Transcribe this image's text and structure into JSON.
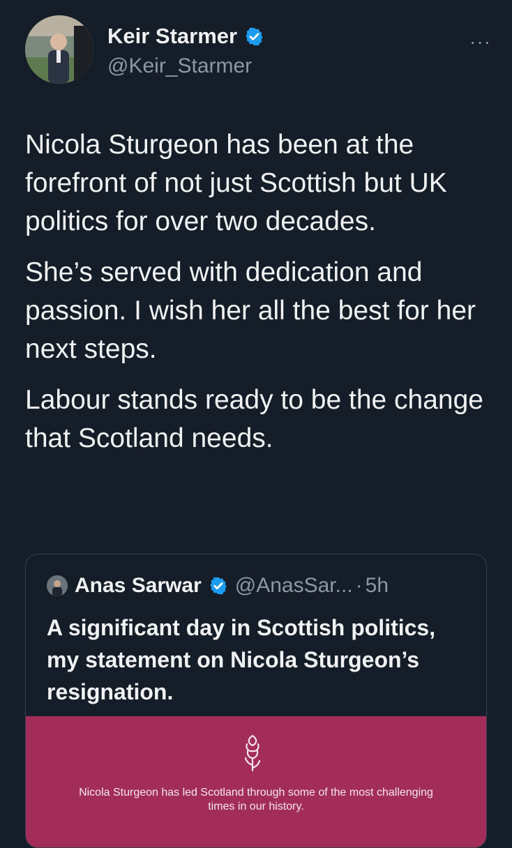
{
  "author": {
    "display_name": "Keir Starmer",
    "handle": "@Keir_Starmer",
    "verified_icon": "verified-badge-icon",
    "more_label": "···"
  },
  "tweet": {
    "paragraphs": [
      "Nicola Sturgeon has been at the forefront of not just Scottish but UK politics for over two decades.",
      "She’s served with dedication and passion. I wish her all the best for her next steps.",
      "Labour stands ready to be the change that Scotland needs."
    ]
  },
  "quoted_tweet": {
    "display_name": "Anas Sarwar",
    "handle": "@AnasSar...",
    "separator": "·",
    "time": "5h",
    "text": "A significant day in Scottish politics, my statement on Nicola Sturgeon’s resignation.",
    "media_text": "Nicola Sturgeon has led Scotland through some of the most challenging times in our history.",
    "media_color": "#a32d59"
  },
  "colors": {
    "background": "#151d28",
    "verified": "#1d9bf0",
    "secondary_text": "#8b98a5"
  }
}
